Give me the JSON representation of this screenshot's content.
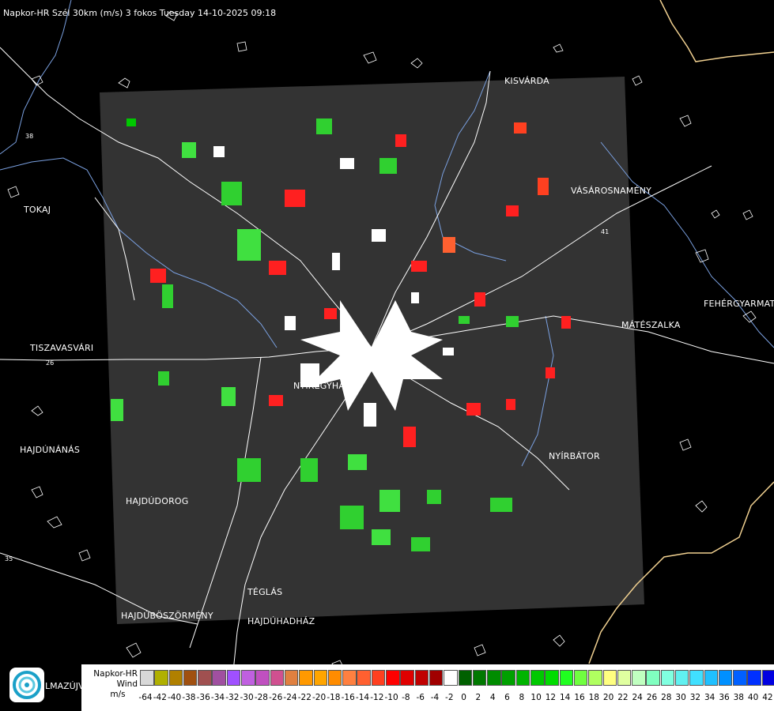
{
  "title": "Napkor-HR Szél 30km (m/s) 3 fokos Tuesday 14-10-2025 09:18",
  "towns": [
    {
      "name": "KISVÁRDA",
      "key": "kisvarda"
    },
    {
      "name": "TOKAJ",
      "key": "tokaj"
    },
    {
      "name": "VÁSÁROSNAMÉNY",
      "key": "vasarosnameny"
    },
    {
      "name": "FEHÉRGYARMAT",
      "key": "fehergyarmat"
    },
    {
      "name": "MÁTÉSZALKA",
      "key": "mateszalka"
    },
    {
      "name": "TISZAVASVÁRI",
      "key": "tiszavasvari"
    },
    {
      "name": "NYÍREGYHÁZA",
      "key": "nyiregyhaza"
    },
    {
      "name": "HAJDÚNÁNÁS",
      "key": "hajdunanas"
    },
    {
      "name": "NYÍRBÁTOR",
      "key": "nyirbator"
    },
    {
      "name": "HAJDÚDOROG",
      "key": "hajdudorog"
    },
    {
      "name": "TÉGLÁS",
      "key": "teglas"
    },
    {
      "name": "HAJDÚBÖSZÖRMÉNY",
      "key": "hajduboszormeny"
    },
    {
      "name": "HAJDÚHADHÁZ",
      "key": "hajduhadhaz"
    }
  ],
  "road_labels": [
    "38",
    "26",
    "35",
    "41"
  ],
  "legend": {
    "line1": "Napkor-HR",
    "line2": "Wind",
    "line3": "m/s",
    "values": [
      "-64",
      "-42",
      "-40",
      "-38",
      "-36",
      "-34",
      "-32",
      "-30",
      "-28",
      "-26",
      "-24",
      "-22",
      "-20",
      "-18",
      "-16",
      "-14",
      "-12",
      "-10",
      "-8",
      "-6",
      "-4",
      "-2",
      "0",
      "2",
      "4",
      "6",
      "8",
      "10",
      "12",
      "14",
      "16",
      "18",
      "20",
      "22",
      "24",
      "26",
      "28",
      "30",
      "32",
      "34",
      "36",
      "38",
      "40",
      "42"
    ],
    "colors": [
      "#d8d8d8",
      "#b0b000",
      "#b08000",
      "#a05010",
      "#a05050",
      "#a050a0",
      "#a050ff",
      "#c060e0",
      "#c050c0",
      "#d05090",
      "#e08040",
      "#ff9900",
      "#ffa500",
      "#ff8c00",
      "#ff8040",
      "#ff6030",
      "#ff4020",
      "#ff0000",
      "#e00000",
      "#c00000",
      "#a00000",
      "#ffffff",
      "#006000",
      "#007800",
      "#008c00",
      "#00a000",
      "#00b400",
      "#00c800",
      "#00dc00",
      "#20ff20",
      "#70ff40",
      "#b0ff60",
      "#ffff80",
      "#e0ffa0",
      "#c0ffc0",
      "#80ffc0",
      "#80ffe0",
      "#60f0f0",
      "#40e0ff",
      "#20c0ff",
      "#0090ff",
      "#0060ff",
      "#0030ff",
      "#0000e0"
    ]
  },
  "logo_text": "LMAZÚJVÁR",
  "colors": {
    "background": "#000000",
    "radar_panel": "#333333",
    "border": "#ffffff",
    "river": "#7aa0e0",
    "country_border": "#f0d090"
  }
}
